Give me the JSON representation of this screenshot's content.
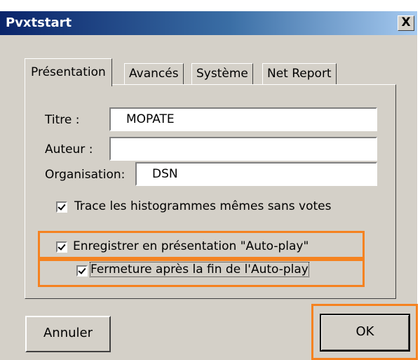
{
  "window": {
    "title": "Pvxtstart",
    "close_glyph": "X"
  },
  "tabs": [
    {
      "label": "Présentation",
      "active": true
    },
    {
      "label": "Avancés",
      "active": false
    },
    {
      "label": "Système",
      "active": false
    },
    {
      "label": "Net Report",
      "active": false
    }
  ],
  "form": {
    "titre_label": "Titre :",
    "titre_value": "MOPATE",
    "auteur_label": "Auteur :",
    "auteur_value": "",
    "organisation_label": "Organisation:",
    "organisation_value": "DSN"
  },
  "checkboxes": {
    "trace_label": "Trace les histogrammes mêmes sans votes",
    "trace_checked": true,
    "autoplay_label": "Enregistrer en présentation \"Auto-play\"",
    "autoplay_checked": true,
    "fermeture_label": "Fermeture après la fin de l'Auto-play",
    "fermeture_checked": true
  },
  "buttons": {
    "cancel_label": "Annuler",
    "ok_label": "OK"
  },
  "colors": {
    "highlight": "#f58220",
    "titlebar": "#0a246a"
  }
}
